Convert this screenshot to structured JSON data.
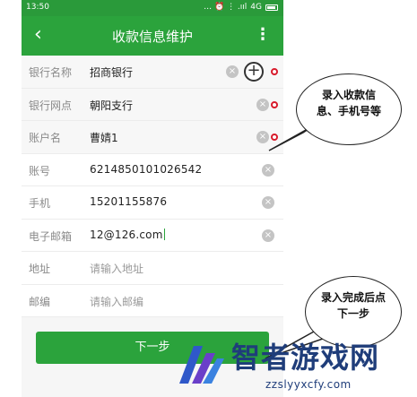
{
  "status": {
    "time": "13:50",
    "network": "4G",
    "icons": "… ⏰ ⋮ .ııl"
  },
  "appbar": {
    "title": "收款信息维护",
    "back_icon": "‹",
    "menu_icon": "⋮"
  },
  "form": {
    "bank_name": {
      "label": "银行名称",
      "value": "招商银行"
    },
    "branch": {
      "label": "银行网点",
      "value": "朝阳支行"
    },
    "account_name": {
      "label": "账户名",
      "value": "曹婧1"
    },
    "account_no": {
      "label": "账号",
      "value": "6214850101026542"
    },
    "phone": {
      "label": "手机",
      "value": "15201155876"
    },
    "email": {
      "label": "电子邮箱",
      "value": "12@126.com"
    },
    "address": {
      "label": "地址",
      "placeholder": "请输入地址"
    },
    "postcode": {
      "label": "邮编",
      "placeholder": "请输入邮编"
    }
  },
  "next_button": {
    "label": "下一步"
  },
  "annotations": {
    "note1": "录入收款信息、手机号等",
    "note2": "录入完成后点下一步"
  },
  "watermark": {
    "title": "智者游戏网",
    "url": "zzslyyxcfy.com"
  },
  "colors": {
    "accent": "#2ba33c",
    "status": "#2a9a3a",
    "marker": "#d81b2c"
  }
}
